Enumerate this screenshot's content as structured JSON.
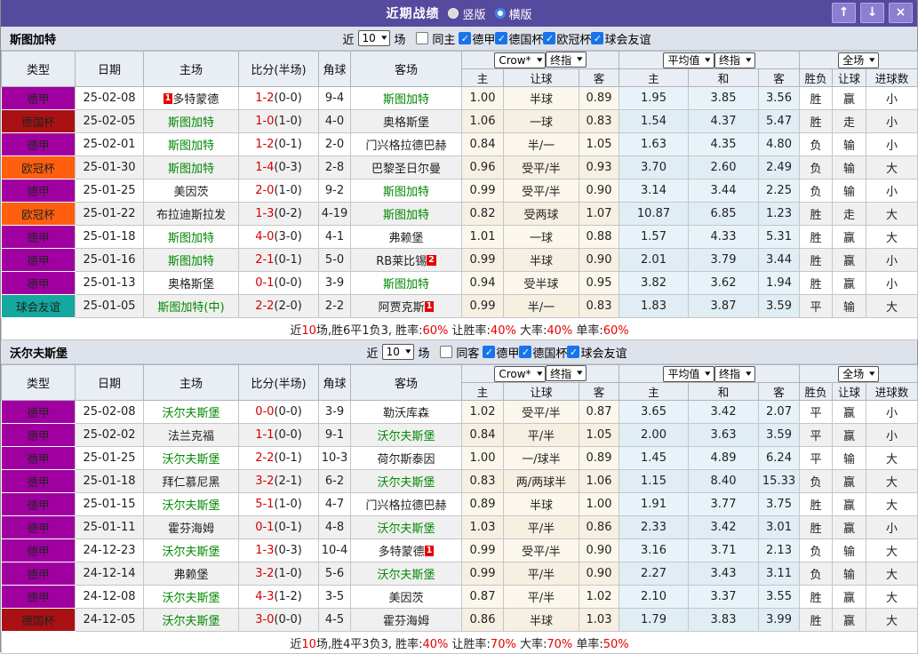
{
  "titlebar": {
    "title": "近期战绩",
    "layout_vertical": "竖版",
    "layout_horizontal": "横版",
    "btn_up": "↑",
    "btn_down": "↓",
    "btn_close": "×"
  },
  "filter_common": {
    "near": "近",
    "count": "10",
    "matches": "场"
  },
  "table_header": {
    "type": "类型",
    "date": "日期",
    "home": "主场",
    "score": "比分(半场)",
    "corner": "角球",
    "away": "客场",
    "odds_source": "Crow*",
    "odds_final": "终指",
    "avg": "平均值",
    "avg_final": "终指",
    "fulltime": "全场",
    "sub_home": "主",
    "sub_handicap": "让球",
    "sub_away": "客",
    "sub_avg_home": "主",
    "sub_avg_draw": "和",
    "sub_avg_away": "客",
    "sub_result": "胜负",
    "sub_handicap_result": "让球",
    "sub_goals": "进球数"
  },
  "league_colors": {
    "德甲": "#a000a0",
    "德国杯": "#aa1114",
    "欧冠杯": "#ff5f0f",
    "球会友谊": "#14a89e"
  },
  "result_colors": {
    "r": "#e60000",
    "g": "#008800",
    "b": "#2323cc"
  },
  "sections": [
    {
      "team": "斯图加特",
      "same_label": "同主",
      "leagues": [
        "德甲",
        "德国杯",
        "欧冠杯",
        "球会友谊"
      ],
      "rows": [
        {
          "league": "德甲",
          "date": "25-02-08",
          "home": {
            "name": "多特蒙德",
            "focus": false,
            "card": "1",
            "card_pos": "before"
          },
          "score": "1-2",
          "half": "(0-0)",
          "corners": "9-4",
          "away": {
            "name": "斯图加特",
            "focus": true
          },
          "crow": [
            "1.00",
            "半球",
            "0.89"
          ],
          "avg": [
            "1.95",
            "3.85",
            "3.56"
          ],
          "result": [
            [
              "胜",
              "r"
            ],
            [
              "赢",
              "r"
            ],
            [
              "小",
              "b"
            ]
          ]
        },
        {
          "league": "德国杯",
          "date": "25-02-05",
          "home": {
            "name": "斯图加特",
            "focus": true
          },
          "score": "1-0",
          "half": "(1-0)",
          "corners": "4-0",
          "away": {
            "name": "奥格斯堡",
            "focus": false
          },
          "crow": [
            "1.06",
            "一球",
            "0.83"
          ],
          "avg": [
            "1.54",
            "4.37",
            "5.47"
          ],
          "result": [
            [
              "胜",
              "r"
            ],
            [
              "走",
              "g"
            ],
            [
              "小",
              "b"
            ]
          ]
        },
        {
          "league": "德甲",
          "date": "25-02-01",
          "home": {
            "name": "斯图加特",
            "focus": true
          },
          "score": "1-2",
          "half": "(0-1)",
          "corners": "2-0",
          "away": {
            "name": "门兴格拉德巴赫",
            "focus": false
          },
          "crow": [
            "0.84",
            "半/一",
            "1.05"
          ],
          "avg": [
            "1.63",
            "4.35",
            "4.80"
          ],
          "result": [
            [
              "负",
              "b"
            ],
            [
              "输",
              "b"
            ],
            [
              "小",
              "b"
            ]
          ]
        },
        {
          "league": "欧冠杯",
          "date": "25-01-30",
          "home": {
            "name": "斯图加特",
            "focus": true
          },
          "score": "1-4",
          "half": "(0-3)",
          "corners": "2-8",
          "away": {
            "name": "巴黎圣日尔曼",
            "focus": false
          },
          "crow": [
            "0.96",
            "受平/半",
            "0.93"
          ],
          "avg": [
            "3.70",
            "2.60",
            "2.49"
          ],
          "result": [
            [
              "负",
              "b"
            ],
            [
              "输",
              "b"
            ],
            [
              "大",
              "r"
            ]
          ]
        },
        {
          "league": "德甲",
          "date": "25-01-25",
          "home": {
            "name": "美因茨",
            "focus": false
          },
          "score": "2-0",
          "half": "(1-0)",
          "corners": "9-2",
          "away": {
            "name": "斯图加特",
            "focus": true
          },
          "crow": [
            "0.99",
            "受平/半",
            "0.90"
          ],
          "avg": [
            "3.14",
            "3.44",
            "2.25"
          ],
          "result": [
            [
              "负",
              "b"
            ],
            [
              "输",
              "b"
            ],
            [
              "小",
              "b"
            ]
          ]
        },
        {
          "league": "欧冠杯",
          "date": "25-01-22",
          "home": {
            "name": "布拉迪斯拉发",
            "focus": false
          },
          "score": "1-3",
          "half": "(0-2)",
          "corners": "4-19",
          "away": {
            "name": "斯图加特",
            "focus": true
          },
          "crow": [
            "0.82",
            "受两球",
            "1.07"
          ],
          "avg": [
            "10.87",
            "6.85",
            "1.23"
          ],
          "result": [
            [
              "胜",
              "r"
            ],
            [
              "走",
              "g"
            ],
            [
              "大",
              "r"
            ]
          ]
        },
        {
          "league": "德甲",
          "date": "25-01-18",
          "home": {
            "name": "斯图加特",
            "focus": true
          },
          "score": "4-0",
          "half": "(3-0)",
          "corners": "4-1",
          "away": {
            "name": "弗赖堡",
            "focus": false
          },
          "crow": [
            "1.01",
            "一球",
            "0.88"
          ],
          "avg": [
            "1.57",
            "4.33",
            "5.31"
          ],
          "result": [
            [
              "胜",
              "r"
            ],
            [
              "赢",
              "r"
            ],
            [
              "大",
              "r"
            ]
          ]
        },
        {
          "league": "德甲",
          "date": "25-01-16",
          "home": {
            "name": "斯图加特",
            "focus": true
          },
          "score": "2-1",
          "half": "(0-1)",
          "corners": "5-0",
          "away": {
            "name": "RB莱比锡",
            "focus": false,
            "card": "2",
            "card_pos": "after"
          },
          "crow": [
            "0.99",
            "半球",
            "0.90"
          ],
          "avg": [
            "2.01",
            "3.79",
            "3.44"
          ],
          "result": [
            [
              "胜",
              "r"
            ],
            [
              "赢",
              "r"
            ],
            [
              "小",
              "b"
            ]
          ]
        },
        {
          "league": "德甲",
          "date": "25-01-13",
          "home": {
            "name": "奥格斯堡",
            "focus": false
          },
          "score": "0-1",
          "half": "(0-0)",
          "corners": "3-9",
          "away": {
            "name": "斯图加特",
            "focus": true
          },
          "crow": [
            "0.94",
            "受半球",
            "0.95"
          ],
          "avg": [
            "3.82",
            "3.62",
            "1.94"
          ],
          "result": [
            [
              "胜",
              "r"
            ],
            [
              "赢",
              "r"
            ],
            [
              "小",
              "b"
            ]
          ]
        },
        {
          "league": "球会友谊",
          "date": "25-01-05",
          "home": {
            "name": "斯图加特(中)",
            "focus": true
          },
          "score": "2-2",
          "half": "(2-0)",
          "corners": "2-2",
          "away": {
            "name": "阿贾克斯",
            "focus": false,
            "card": "1",
            "card_pos": "after"
          },
          "crow": [
            "0.99",
            "半/一",
            "0.83"
          ],
          "avg": [
            "1.83",
            "3.87",
            "3.59"
          ],
          "result": [
            [
              "平",
              "g"
            ],
            [
              "输",
              "b"
            ],
            [
              "大",
              "r"
            ]
          ]
        }
      ],
      "summary": [
        [
          "近",
          "k"
        ],
        [
          "10",
          "r"
        ],
        [
          "场,胜6平1负3, 胜率:",
          "k"
        ],
        [
          "60%",
          "r"
        ],
        [
          " 让胜率:",
          "k"
        ],
        [
          "40%",
          "r"
        ],
        [
          " 大率:",
          "k"
        ],
        [
          "40%",
          "r"
        ],
        [
          " 单率:",
          "k"
        ],
        [
          "60%",
          "r"
        ]
      ]
    },
    {
      "team": "沃尔夫斯堡",
      "same_label": "同客",
      "leagues": [
        "德甲",
        "德国杯",
        "球会友谊"
      ],
      "rows": [
        {
          "league": "德甲",
          "date": "25-02-08",
          "home": {
            "name": "沃尔夫斯堡",
            "focus": true
          },
          "score": "0-0",
          "half": "(0-0)",
          "corners": "3-9",
          "away": {
            "name": "勒沃库森",
            "focus": false
          },
          "crow": [
            "1.02",
            "受平/半",
            "0.87"
          ],
          "avg": [
            "3.65",
            "3.42",
            "2.07"
          ],
          "result": [
            [
              "平",
              "g"
            ],
            [
              "赢",
              "r"
            ],
            [
              "小",
              "b"
            ]
          ]
        },
        {
          "league": "德甲",
          "date": "25-02-02",
          "home": {
            "name": "法兰克福",
            "focus": false
          },
          "score": "1-1",
          "half": "(0-0)",
          "corners": "9-1",
          "away": {
            "name": "沃尔夫斯堡",
            "focus": true
          },
          "crow": [
            "0.84",
            "平/半",
            "1.05"
          ],
          "avg": [
            "2.00",
            "3.63",
            "3.59"
          ],
          "result": [
            [
              "平",
              "g"
            ],
            [
              "赢",
              "r"
            ],
            [
              "小",
              "b"
            ]
          ]
        },
        {
          "league": "德甲",
          "date": "25-01-25",
          "home": {
            "name": "沃尔夫斯堡",
            "focus": true
          },
          "score": "2-2",
          "half": "(0-1)",
          "corners": "10-3",
          "away": {
            "name": "荷尔斯泰因",
            "focus": false
          },
          "crow": [
            "1.00",
            "一/球半",
            "0.89"
          ],
          "avg": [
            "1.45",
            "4.89",
            "6.24"
          ],
          "result": [
            [
              "平",
              "g"
            ],
            [
              "输",
              "b"
            ],
            [
              "大",
              "r"
            ]
          ]
        },
        {
          "league": "德甲",
          "date": "25-01-18",
          "home": {
            "name": "拜仁慕尼黑",
            "focus": false
          },
          "score": "3-2",
          "half": "(2-1)",
          "corners": "6-2",
          "away": {
            "name": "沃尔夫斯堡",
            "focus": true
          },
          "crow": [
            "0.83",
            "两/两球半",
            "1.06"
          ],
          "avg": [
            "1.15",
            "8.40",
            "15.33"
          ],
          "result": [
            [
              "负",
              "b"
            ],
            [
              "赢",
              "r"
            ],
            [
              "大",
              "r"
            ]
          ]
        },
        {
          "league": "德甲",
          "date": "25-01-15",
          "home": {
            "name": "沃尔夫斯堡",
            "focus": true
          },
          "score": "5-1",
          "half": "(1-0)",
          "corners": "4-7",
          "away": {
            "name": "门兴格拉德巴赫",
            "focus": false
          },
          "crow": [
            "0.89",
            "半球",
            "1.00"
          ],
          "avg": [
            "1.91",
            "3.77",
            "3.75"
          ],
          "result": [
            [
              "胜",
              "r"
            ],
            [
              "赢",
              "r"
            ],
            [
              "大",
              "r"
            ]
          ]
        },
        {
          "league": "德甲",
          "date": "25-01-11",
          "home": {
            "name": "霍芬海姆",
            "focus": false
          },
          "score": "0-1",
          "half": "(0-1)",
          "corners": "4-8",
          "away": {
            "name": "沃尔夫斯堡",
            "focus": true
          },
          "crow": [
            "1.03",
            "平/半",
            "0.86"
          ],
          "avg": [
            "2.33",
            "3.42",
            "3.01"
          ],
          "result": [
            [
              "胜",
              "r"
            ],
            [
              "赢",
              "r"
            ],
            [
              "小",
              "b"
            ]
          ]
        },
        {
          "league": "德甲",
          "date": "24-12-23",
          "home": {
            "name": "沃尔夫斯堡",
            "focus": true
          },
          "score": "1-3",
          "half": "(0-3)",
          "corners": "10-4",
          "away": {
            "name": "多特蒙德",
            "focus": false,
            "card": "1",
            "card_pos": "after"
          },
          "crow": [
            "0.99",
            "受平/半",
            "0.90"
          ],
          "avg": [
            "3.16",
            "3.71",
            "2.13"
          ],
          "result": [
            [
              "负",
              "b"
            ],
            [
              "输",
              "b"
            ],
            [
              "大",
              "r"
            ]
          ]
        },
        {
          "league": "德甲",
          "date": "24-12-14",
          "home": {
            "name": "弗赖堡",
            "focus": false
          },
          "score": "3-2",
          "half": "(1-0)",
          "corners": "5-6",
          "away": {
            "name": "沃尔夫斯堡",
            "focus": true
          },
          "crow": [
            "0.99",
            "平/半",
            "0.90"
          ],
          "avg": [
            "2.27",
            "3.43",
            "3.11"
          ],
          "result": [
            [
              "负",
              "b"
            ],
            [
              "输",
              "b"
            ],
            [
              "大",
              "r"
            ]
          ]
        },
        {
          "league": "德甲",
          "date": "24-12-08",
          "home": {
            "name": "沃尔夫斯堡",
            "focus": true
          },
          "score": "4-3",
          "half": "(1-2)",
          "corners": "3-5",
          "away": {
            "name": "美因茨",
            "focus": false
          },
          "crow": [
            "0.87",
            "平/半",
            "1.02"
          ],
          "avg": [
            "2.10",
            "3.37",
            "3.55"
          ],
          "result": [
            [
              "胜",
              "r"
            ],
            [
              "赢",
              "r"
            ],
            [
              "大",
              "r"
            ]
          ]
        },
        {
          "league": "德国杯",
          "date": "24-12-05",
          "home": {
            "name": "沃尔夫斯堡",
            "focus": true
          },
          "score": "3-0",
          "half": "(0-0)",
          "corners": "4-5",
          "away": {
            "name": "霍芬海姆",
            "focus": false
          },
          "crow": [
            "0.86",
            "半球",
            "1.03"
          ],
          "avg": [
            "1.79",
            "3.83",
            "3.99"
          ],
          "result": [
            [
              "胜",
              "r"
            ],
            [
              "赢",
              "r"
            ],
            [
              "大",
              "r"
            ]
          ]
        }
      ],
      "summary": [
        [
          "近",
          "k"
        ],
        [
          "10",
          "r"
        ],
        [
          "场,胜4平3负3, 胜率:",
          "k"
        ],
        [
          "40%",
          "r"
        ],
        [
          " 让胜率:",
          "k"
        ],
        [
          "70%",
          "r"
        ],
        [
          " 大率:",
          "k"
        ],
        [
          "70%",
          "r"
        ],
        [
          " 单率:",
          "k"
        ],
        [
          "50%",
          "r"
        ]
      ]
    }
  ]
}
